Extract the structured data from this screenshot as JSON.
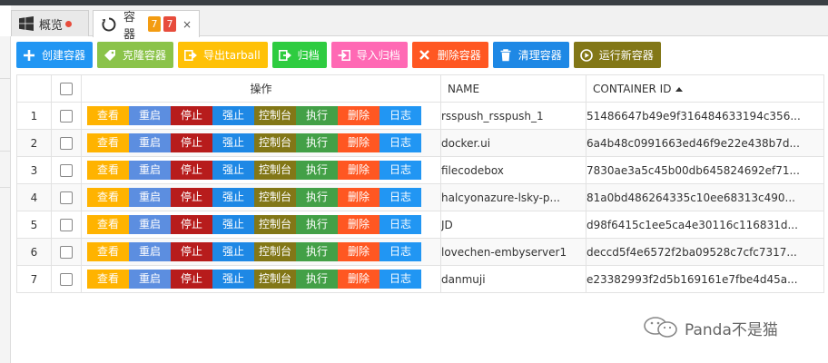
{
  "tabs": [
    {
      "label": "概览",
      "icon": "windows-icon",
      "dot_color": "#e74c3c"
    },
    {
      "label": "容器",
      "icon": "refresh-icon",
      "badges": [
        {
          "value": "7",
          "color": "#f39c12"
        },
        {
          "value": "7",
          "color": "#e74c3c"
        }
      ],
      "close": "×"
    }
  ],
  "toolbar": [
    {
      "label": "创建容器",
      "icon": "plus-icon",
      "color": "#2196f3"
    },
    {
      "label": "克隆容器",
      "icon": "tag-icon",
      "color": "#8bc34a"
    },
    {
      "label": "导出tarball",
      "icon": "export-icon",
      "color": "#ffc107"
    },
    {
      "label": "归档",
      "icon": "archive-icon",
      "color": "#2ecc40"
    },
    {
      "label": "导入归档",
      "icon": "import-icon",
      "color": "#ff69b4"
    },
    {
      "label": "删除容器",
      "icon": "times-icon",
      "color": "#ff5722"
    },
    {
      "label": "清理容器",
      "icon": "trash-icon",
      "color": "#1e88e5"
    },
    {
      "label": "运行新容器",
      "icon": "play-circle-icon",
      "color": "#827717"
    }
  ],
  "table": {
    "headers": {
      "ops": "操作",
      "name": "NAME",
      "id": "CONTAINER ID"
    },
    "actions": [
      {
        "label": "查看",
        "color": "#ffb300"
      },
      {
        "label": "重启",
        "color": "#5c8ee0"
      },
      {
        "label": "停止",
        "color": "#b71c1c"
      },
      {
        "label": "强止",
        "color": "#1e88e5"
      },
      {
        "label": "控制台",
        "color": "#827717"
      },
      {
        "label": "执行",
        "color": "#43a047"
      },
      {
        "label": "删除",
        "color": "#ff5722"
      },
      {
        "label": "日志",
        "color": "#2196f3"
      }
    ],
    "rows": [
      {
        "idx": "1",
        "name": "rsspush_rsspush_1",
        "id": "51486647b49e9f316484633194c356..."
      },
      {
        "idx": "2",
        "name": "docker.ui",
        "id": "6a4b48c0991663ed46f9e22e438b7d..."
      },
      {
        "idx": "3",
        "name": "filecodebox",
        "id": "7830ae3a5c45b00db645824692ef71..."
      },
      {
        "idx": "4",
        "name": "halcyonazure-lsky-p...",
        "id": "81a0bd486264335c10ee68313c490..."
      },
      {
        "idx": "5",
        "name": "JD",
        "id": "d98f6415c1ee5ca4e30116c116831d..."
      },
      {
        "idx": "6",
        "name": "lovechen-embyserver1",
        "id": "deccd5f4e6572f2ba09528c7cfc7317..."
      },
      {
        "idx": "7",
        "name": "danmuji",
        "id": "e23382993f2d5b169161e7fbe4d45a..."
      }
    ]
  },
  "watermark": {
    "text": "Panda不是猫",
    "icon": "wechat-icon"
  }
}
